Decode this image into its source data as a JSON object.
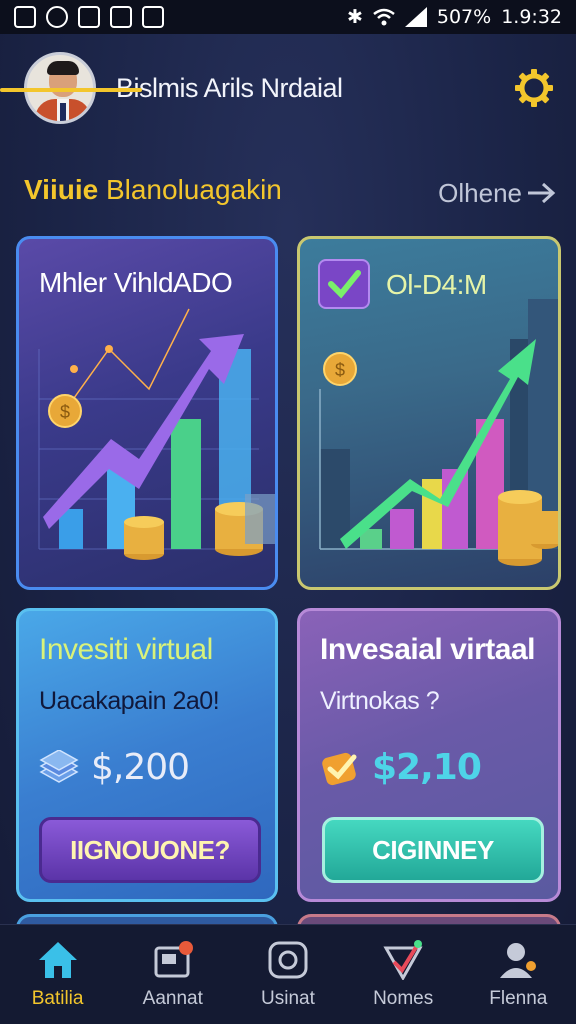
{
  "status_bar": {
    "battery": "507%",
    "time": "1.9:32",
    "icons": [
      "notification-icon",
      "whatsapp-icon",
      "messenger-icon",
      "instagram-icon",
      "tiktok-icon",
      "bluetooth-icon",
      "wifi-icon",
      "signal-icon"
    ]
  },
  "header": {
    "title": "Bislmis Arils Nrdaial",
    "settings_icon": "gear-icon"
  },
  "section": {
    "title_bold": "Viiuie",
    "title_rest": " Blanoluagakin",
    "see_all": "Olhene"
  },
  "cards": [
    {
      "title": "Mhler VihldADO",
      "type": "growth-chart"
    },
    {
      "title": "Ol-D4:M",
      "type": "growth-chart-city"
    }
  ],
  "investments": [
    {
      "title": "Invesiti virtual",
      "subtitle": "Uacakapain 2a0!",
      "amount": "$,200",
      "icon": "money-stack-icon",
      "button": "IIGNOUONE?"
    },
    {
      "title": "Invesaial virtaal",
      "subtitle": "Virtnokas ?",
      "amount": "$2,10",
      "icon": "check-badge-icon",
      "button": "CIGINNEY"
    }
  ],
  "bottom_nav": [
    {
      "label": "Batilia",
      "icon": "home-icon",
      "active": true
    },
    {
      "label": "Aannat",
      "icon": "portfolio-icon",
      "active": false
    },
    {
      "label": "Usinat",
      "icon": "camera-icon",
      "active": false
    },
    {
      "label": "Nomes",
      "icon": "chart-icon",
      "active": false
    },
    {
      "label": "Flenna",
      "icon": "profile-icon",
      "active": false
    }
  ],
  "colors": {
    "accent": "#f3c62c",
    "background": "#1b2447",
    "nav_bg": "#141a32"
  }
}
